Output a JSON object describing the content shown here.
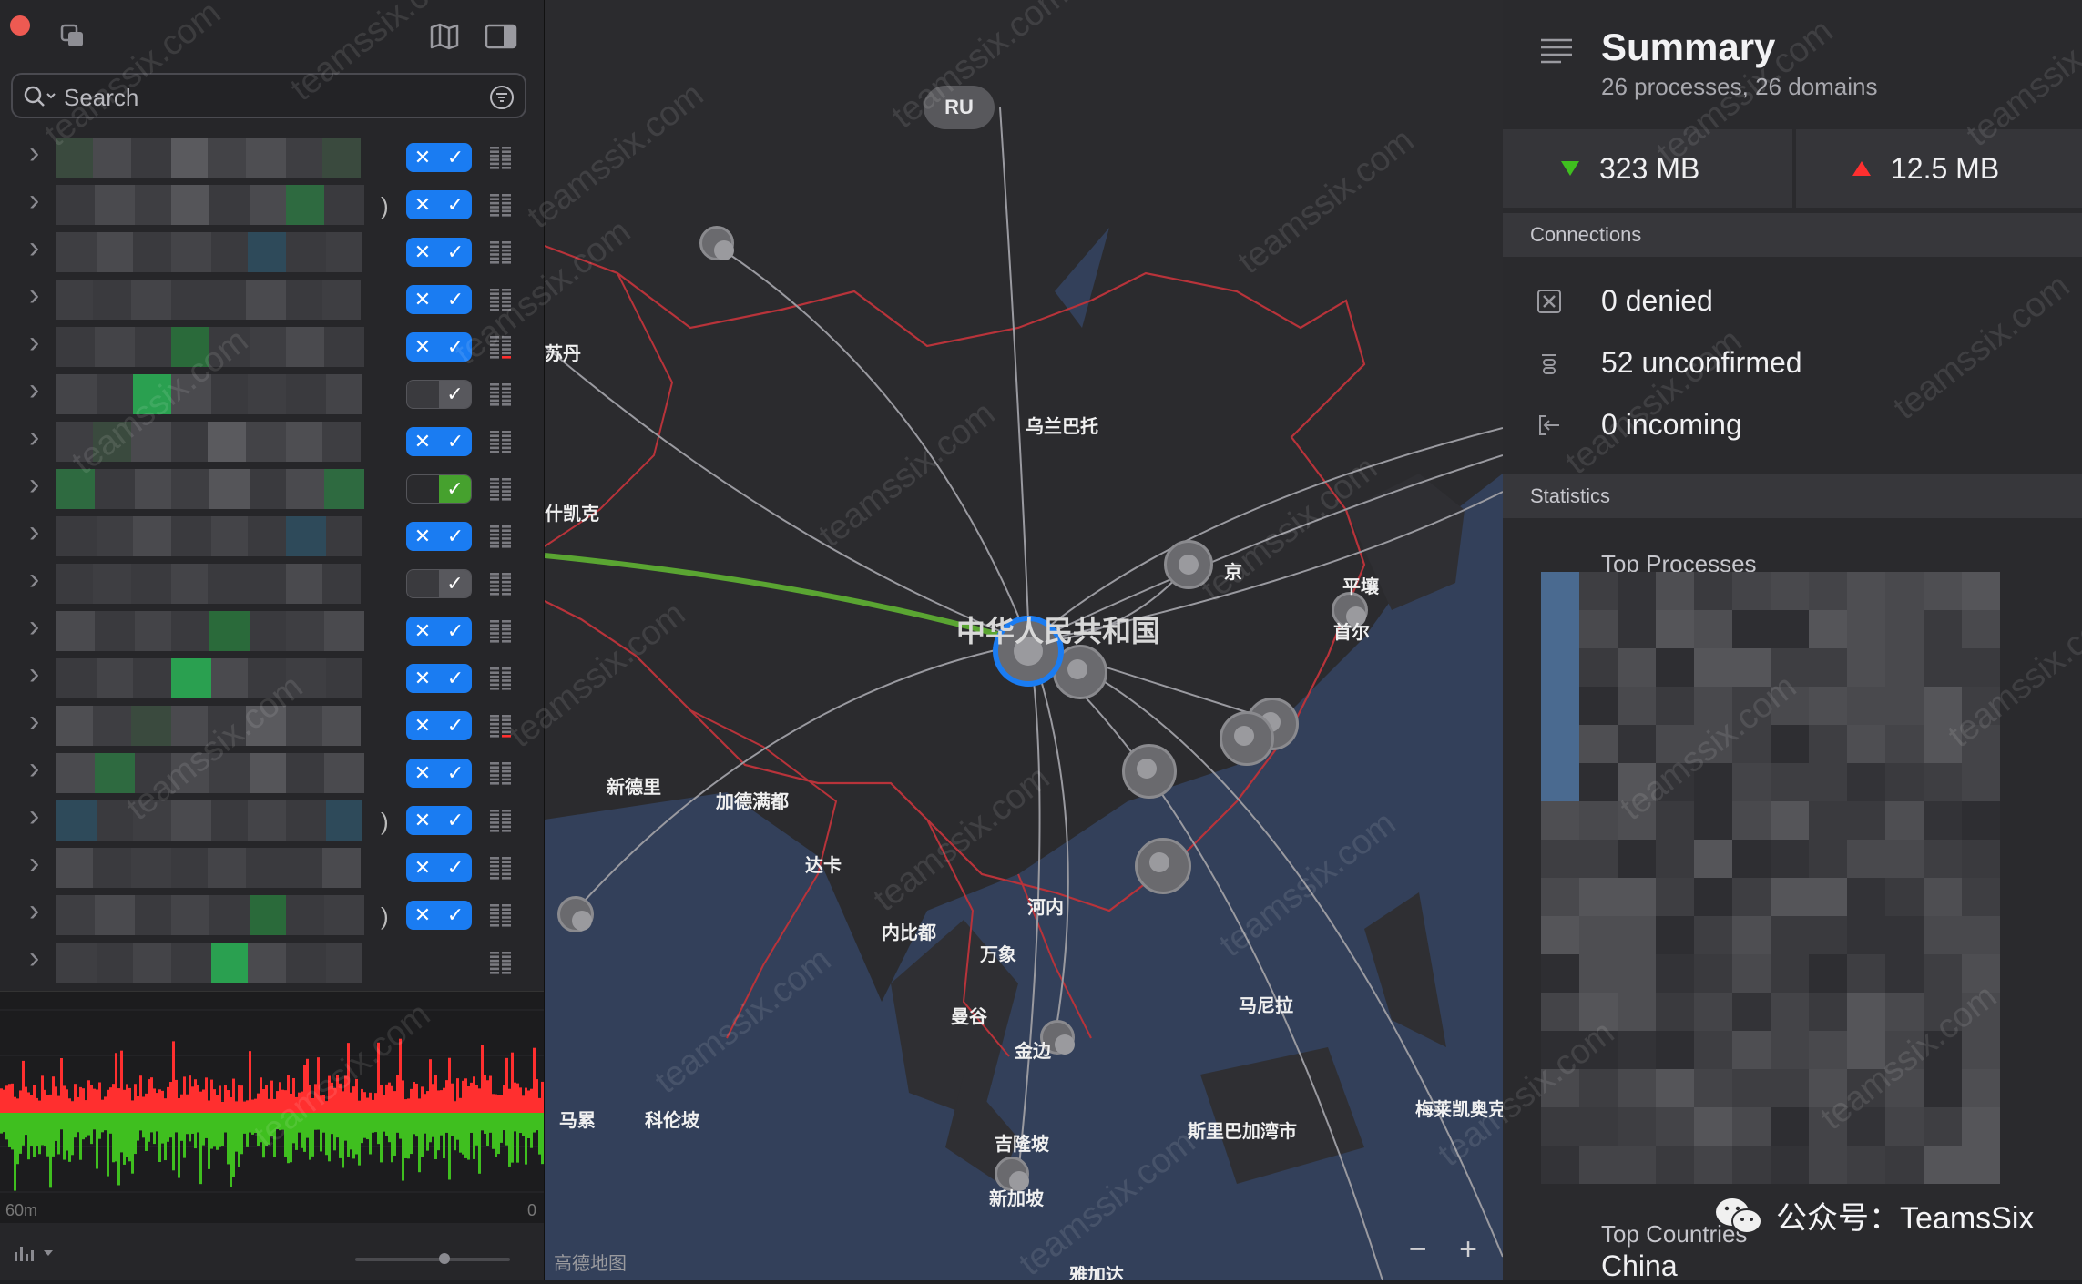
{
  "left_panel": {
    "search": {
      "placeholder": "Search"
    },
    "rows": [
      {
        "toggle": "on",
        "paren": false,
        "alert": false
      },
      {
        "toggle": "on",
        "paren": true,
        "alert": false
      },
      {
        "toggle": "on",
        "paren": false,
        "alert": false
      },
      {
        "toggle": "on",
        "paren": false,
        "alert": false
      },
      {
        "toggle": "on",
        "paren": false,
        "alert": true
      },
      {
        "toggle": "off",
        "paren": false,
        "alert": false
      },
      {
        "toggle": "on",
        "paren": false,
        "alert": false
      },
      {
        "toggle": "allow",
        "paren": false,
        "alert": false
      },
      {
        "toggle": "on",
        "paren": false,
        "alert": false
      },
      {
        "toggle": "off",
        "paren": false,
        "alert": false
      },
      {
        "toggle": "on",
        "paren": false,
        "alert": false
      },
      {
        "toggle": "on",
        "paren": false,
        "alert": false
      },
      {
        "toggle": "on",
        "paren": false,
        "alert": true
      },
      {
        "toggle": "on",
        "paren": false,
        "alert": false
      },
      {
        "toggle": "on",
        "paren": true,
        "alert": false
      },
      {
        "toggle": "on",
        "paren": false,
        "alert": false
      },
      {
        "toggle": "on",
        "paren": true,
        "alert": false
      },
      {
        "toggle": "none",
        "paren": false,
        "alert": false
      }
    ],
    "graph": {
      "left_label": "60m",
      "right_label": "0"
    },
    "colors": {
      "download": "#3fbf1f",
      "upload": "#ff2f2f",
      "accent": "#1a7cf2"
    }
  },
  "map": {
    "labels": {
      "ru": "RU",
      "sudan": "苏丹",
      "ulaanbaatar": "乌兰巴托",
      "tashkent": "什凯克",
      "china": "中华人民共和国",
      "beijing": "京",
      "pyongyang": "平壤",
      "seoul": "首尔",
      "new_delhi": "新德里",
      "kathmandu": "加德满都",
      "dhaka": "达卡",
      "naypyidaw": "内比都",
      "hanoi": "河内",
      "vientiane": "万象",
      "bangkok": "曼谷",
      "phnom_penh": "金边",
      "manila": "马尼拉",
      "male": "马累",
      "colombo": "科伦坡",
      "kuala_lumpur": "吉隆坡",
      "singapore": "新加坡",
      "bandar": "斯里巴加湾市",
      "melekeok": "梅莱凯奥克",
      "jakarta": "雅加达"
    },
    "zoom": {
      "minus": "−",
      "plus": "+"
    },
    "attribution": "高德地图"
  },
  "summary": {
    "title": "Summary",
    "subtitle": "26 processes, 26 domains",
    "download": "323 MB",
    "upload": "12.5 MB",
    "connections_header": "Connections",
    "denied": "0 denied",
    "unconfirmed": "52 unconfirmed",
    "incoming": "0 incoming",
    "statistics_header": "Statistics",
    "top_processes": "Top Processes",
    "top_countries": "Top Countries",
    "country": "China"
  },
  "watermark": {
    "text": "teamssix.com",
    "wechat": "公众号：TeamsSix"
  }
}
